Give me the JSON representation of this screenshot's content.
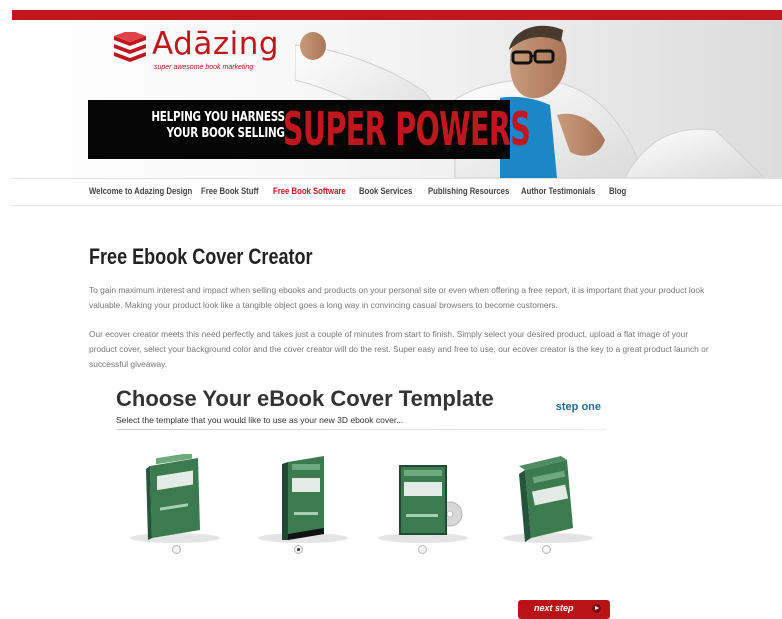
{
  "site": {
    "logo_text": "Adāzing",
    "logo_tagline": "super awesome book marketing",
    "banner_line1": "HELPING YOU HARNESS",
    "banner_line2": "YOUR BOOK SELLING",
    "banner_highlight": "SUPER POWERS"
  },
  "nav": {
    "items": [
      {
        "label": "Welcome to Adazing Design",
        "active": false
      },
      {
        "label": "Free Book Stuff",
        "active": false
      },
      {
        "label": "Free Book Software",
        "active": true
      },
      {
        "label": "Book Services",
        "active": false
      },
      {
        "label": "Publishing Resources",
        "active": false
      },
      {
        "label": "Author Testimonials",
        "active": false
      },
      {
        "label": "Blog",
        "active": false
      }
    ]
  },
  "page": {
    "title": "Free Ebook Cover Creator",
    "paragraph1": "To gain maximum interest and impact when selling ebooks and products on your personal site or even when offering a free report, it is important that your product look valuable. Making your product look like a tangible object goes a long way in convincing casual browsers to become customers.",
    "paragraph2": "Our ecover creator meets this need perfectly and takes just a couple of minutes from start to finish. Simply select your desired product, upload a flat image of your product cover, select your background color and the cover creator will do the rest. Super easy and free to use, our ecover creator is the key to a great product launch or successful giveaway."
  },
  "creator": {
    "title": "Choose Your eBook Cover Template",
    "subtitle": "Select the template that you would like to use as your new 3D ebook cover...",
    "step_label": "step one",
    "templates": [
      {
        "name": "paperback-book",
        "selected": false
      },
      {
        "name": "hardcover-book",
        "selected": true
      },
      {
        "name": "dvd-case",
        "selected": false
      },
      {
        "name": "software-box",
        "selected": false
      }
    ],
    "next_label": "next step"
  },
  "colors": {
    "brand_red": "#c0161d",
    "banner_black": "#050505",
    "step_blue": "#1e6e94",
    "cover_green": "#3c7a4f"
  }
}
